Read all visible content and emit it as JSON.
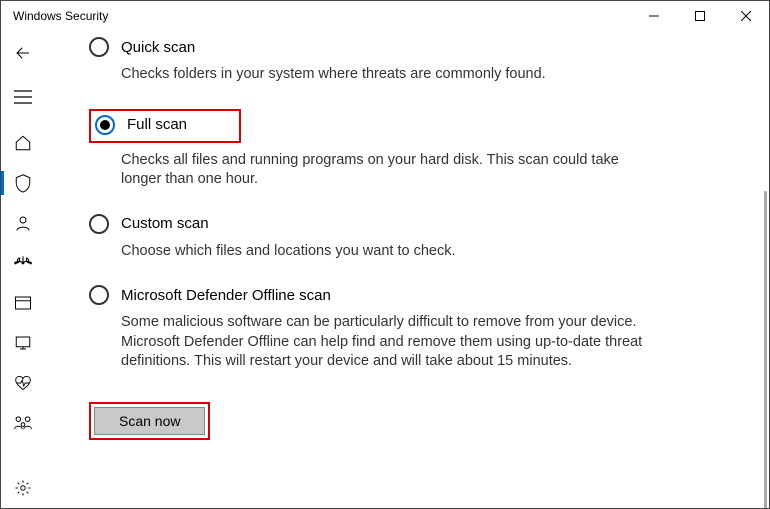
{
  "window": {
    "title": "Windows Security"
  },
  "options": {
    "quick": {
      "label": "Quick scan",
      "desc": "Checks folders in your system where threats are commonly found."
    },
    "full": {
      "label": "Full scan",
      "desc": "Checks all files and running programs on your hard disk. This scan could take longer than one hour."
    },
    "custom": {
      "label": "Custom scan",
      "desc": "Choose which files and locations you want to check."
    },
    "offline": {
      "label": "Microsoft Defender Offline scan",
      "desc": "Some malicious software can be particularly difficult to remove from your device. Microsoft Defender Offline can help find and remove them using up-to-date threat definitions. This will restart your device and will take about 15 minutes."
    }
  },
  "actions": {
    "scan_now": "Scan now"
  },
  "selected": "full",
  "highlight_color": "#d80000",
  "accent_color": "#006dca"
}
